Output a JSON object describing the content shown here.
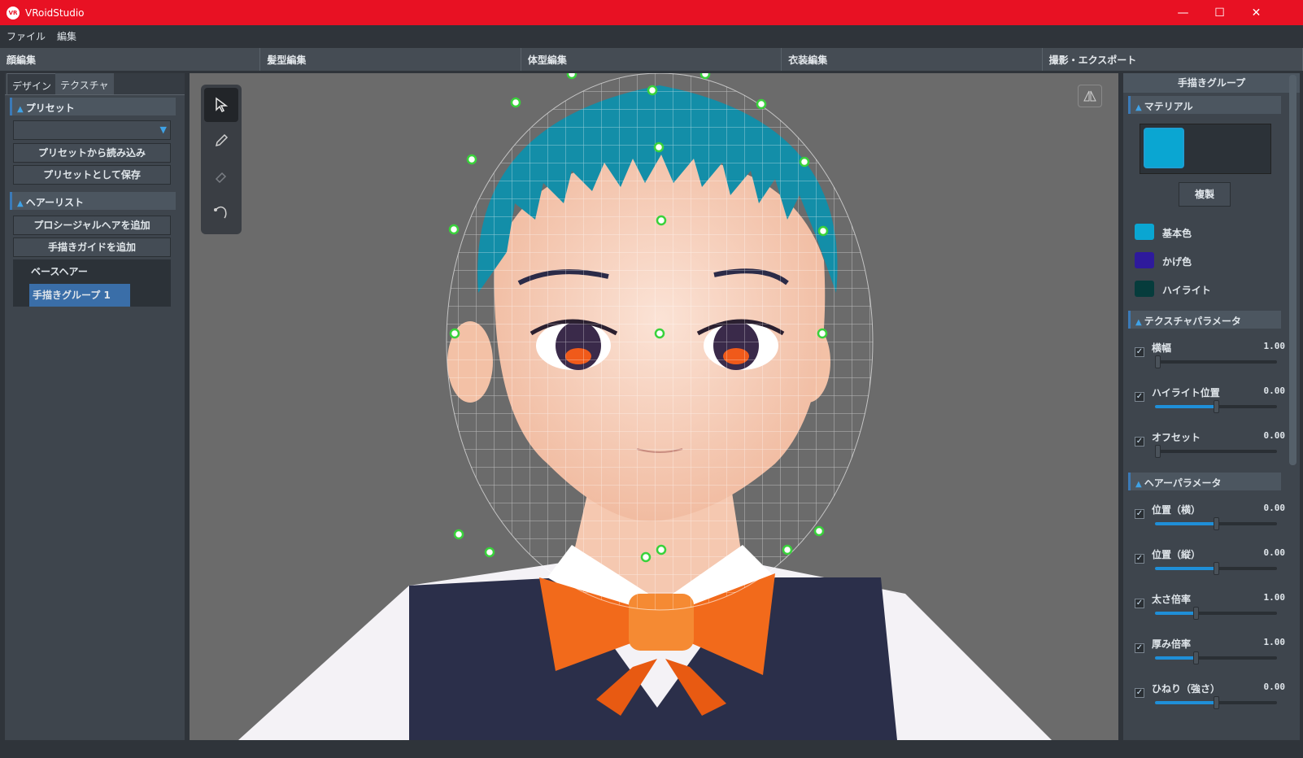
{
  "window": {
    "title": "VRoidStudio",
    "icon_text": "VR",
    "controls": [
      "—",
      "☐",
      "✕"
    ]
  },
  "menu": [
    "ファイル",
    "編集"
  ],
  "mode_tabs": [
    "顔編集",
    "髪型編集",
    "体型編集",
    "衣装編集",
    "撮影・エクスポート"
  ],
  "left": {
    "subtabs": [
      "デザイン",
      "テクスチャ"
    ],
    "preset_section": "プリセット",
    "preset_dropdown_value": "",
    "load_preset": "プリセットから読み込み",
    "save_preset": "プリセットとして保存",
    "hairlist_section": "ヘアーリスト",
    "add_procedural": "プロシージャルヘアを追加",
    "add_guide": "手描きガイドを追加",
    "hair_items": [
      "ベースヘアー",
      "手描きグループ 1"
    ]
  },
  "right": {
    "header": "手描きグループ",
    "material_section": "マテリアル",
    "material_color": "#0aa6d2",
    "duplicate": "複製",
    "colors": [
      {
        "label": "基本色",
        "color": "#0aa6d2"
      },
      {
        "label": "かげ色",
        "color": "#2e1a9c"
      },
      {
        "label": "ハイライト",
        "color": "#063c3c"
      }
    ],
    "texture_section": "テクスチャパラメータ",
    "texture_params": [
      {
        "label": "横幅",
        "value": "1.00",
        "level": 0
      },
      {
        "label": "ハイライト位置",
        "value": "0.00",
        "level": 0.5
      },
      {
        "label": "オフセット",
        "value": "0.00",
        "level": 0
      }
    ],
    "hair_section": "ヘアーパラメータ",
    "hair_params": [
      {
        "label": "位置（横）",
        "value": "0.00",
        "level": 0.5
      },
      {
        "label": "位置（縦）",
        "value": "0.00",
        "level": 0.5
      },
      {
        "label": "太さ倍率",
        "value": "1.00",
        "level": 0.33
      },
      {
        "label": "厚み倍率",
        "value": "1.00",
        "level": 0.33
      },
      {
        "label": "ひねり（強さ）",
        "value": "0.00",
        "level": 0.5
      }
    ]
  }
}
